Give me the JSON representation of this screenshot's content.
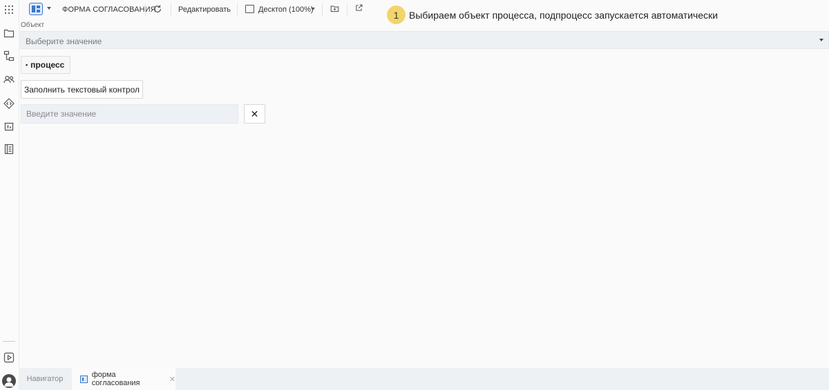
{
  "toolbar": {
    "title": "ФОРМА СОГЛАСОВАНИЯ",
    "edit_label": "Редактировать",
    "device_label": "Десктоп (100%)"
  },
  "hint": {
    "step": "1",
    "text": "Выбираем объект процесса, подпроцесс запускается автоматически",
    "color": "#f3d46b"
  },
  "form": {
    "object_label": "Объект",
    "object_placeholder": "Выберите значение",
    "process_label": "процесс",
    "fill_button_label": "Заполнить текстовый контрол",
    "text_placeholder": "Введите значение",
    "clear_label": "✕"
  },
  "sidebar": {
    "icons": [
      "apps-grid-icon",
      "folder-icon",
      "hierarchy-icon",
      "users-icon",
      "code-diamond-icon",
      "text-box-icon",
      "book-icon",
      "play-icon",
      "user-avatar-icon"
    ]
  },
  "bottom_tabs": [
    {
      "label": "Навигатор",
      "active": false
    },
    {
      "label": "форма согласования",
      "active": true
    }
  ],
  "colors": {
    "accent": "#3a78c8",
    "hint_badge": "#f3d46b"
  }
}
